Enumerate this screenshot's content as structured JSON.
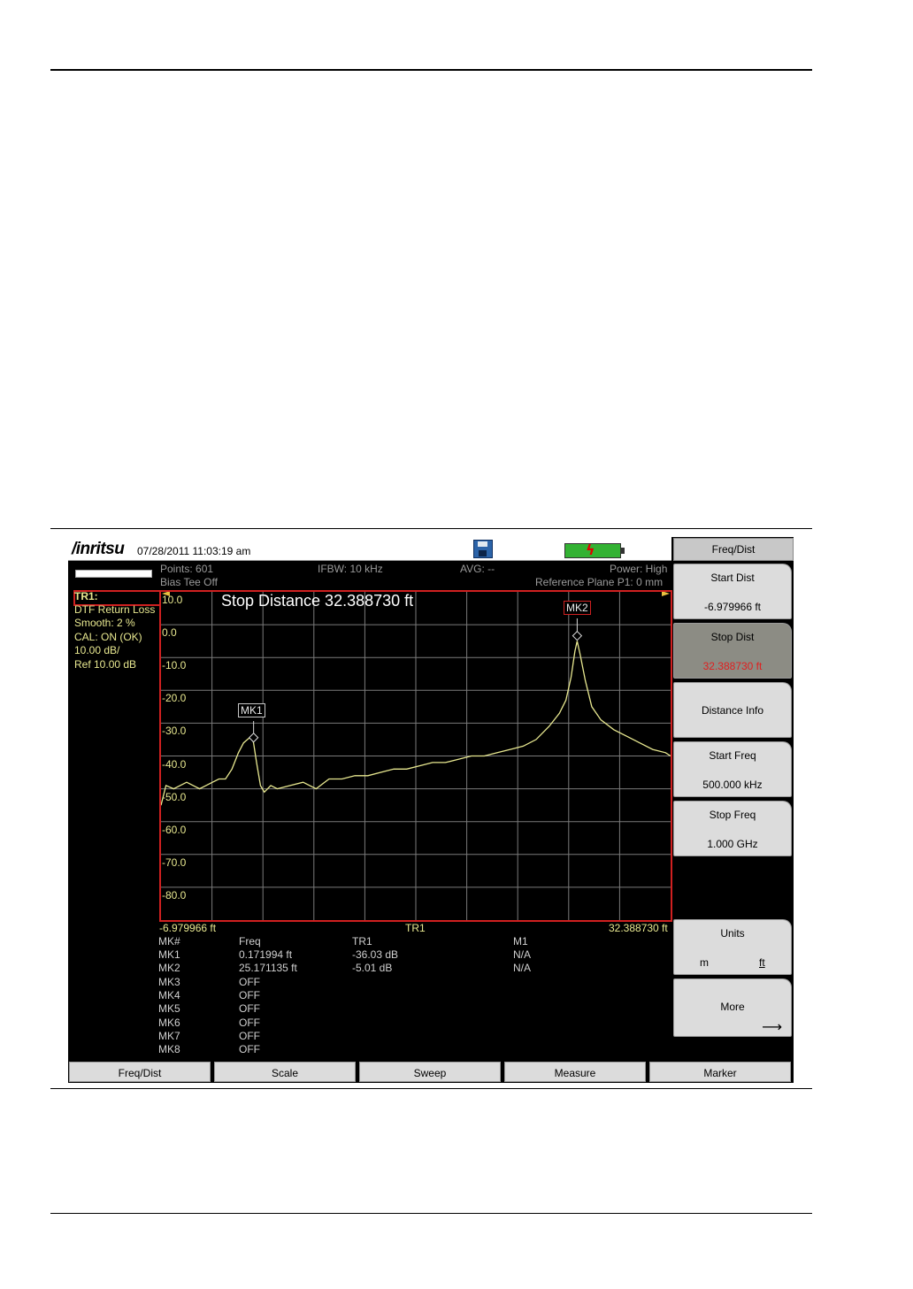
{
  "header": {
    "brand": "/inritsu",
    "datetime": "07/28/2011 11:03:19 am"
  },
  "status": {
    "points": "Points: 601",
    "ifbw": "IFBW: 10 kHz",
    "avg": "AVG: --",
    "power": "Power: High",
    "bias": "Bias Tee Off",
    "ref_plane": "Reference Plane P1: 0 mm"
  },
  "trace_info": {
    "tr": "TR1:",
    "mode": "DTF Return Loss",
    "smooth": "Smooth: 2 %",
    "cal": "CAL: ON (OK)",
    "scale": "10.00 dB/",
    "ref": "Ref 10.00 dB"
  },
  "plot": {
    "banner": "Stop Distance 32.388730 ft",
    "y_ticks": [
      "10.0",
      "0.0",
      "-10.0",
      "-20.0",
      "-30.0",
      "-40.0",
      "-50.0",
      "-60.0",
      "-70.0",
      "-80.0"
    ],
    "x_start": "-6.979966 ft",
    "x_center": "TR1",
    "x_stop": "32.388730 ft",
    "mk1_label": "MK1",
    "mk2_label": "MK2"
  },
  "chart_data": {
    "type": "line",
    "xlim": [
      -6.979966,
      32.38873
    ],
    "ylim": [
      -90,
      10
    ],
    "ylabel": "",
    "xlabel": "TR1",
    "series": [
      {
        "x": [
          -6.98,
          -6.6,
          -6.0,
          -5.0,
          -4.0,
          -3.0,
          -2.5,
          -2.0,
          -1.5,
          -1.0,
          -0.6,
          -0.3,
          0.0,
          0.17,
          0.4,
          0.7,
          1.0,
          1.5,
          2.0,
          3.0,
          4.0,
          5.0,
          6.0,
          7.0,
          8.0,
          9.0,
          10.0,
          11.0,
          12.0,
          13.0,
          14.0,
          15.0,
          16.0,
          17.0,
          18.0,
          19.0,
          20.0,
          21.0,
          22.0,
          23.0,
          23.8,
          24.3,
          24.7,
          25.0,
          25.17,
          25.4,
          25.8,
          26.3,
          27.0,
          28.0,
          29.0,
          30.0,
          31.0,
          32.0,
          32.39
        ],
        "y": [
          -55,
          -49,
          -50,
          -48,
          -50,
          -48,
          -47,
          -47,
          -44,
          -39,
          -36,
          -35,
          -34,
          -36,
          -42,
          -49,
          -51,
          -49,
          -50,
          -49,
          -48,
          -50,
          -47,
          -47,
          -46,
          -46,
          -45,
          -44,
          -44,
          -43,
          -42,
          -42,
          -41,
          -40,
          -40,
          -39,
          -38,
          -37,
          -35,
          -31,
          -27,
          -23,
          -16,
          -8,
          -5,
          -9,
          -17,
          -25,
          -29,
          -32,
          -34,
          -36,
          -38,
          -39,
          -40
        ]
      }
    ]
  },
  "markers": {
    "headers": [
      "MK#",
      "Freq",
      "TR1",
      "M1"
    ],
    "rows": [
      [
        "MK1",
        "0.171994 ft",
        "-36.03 dB",
        "N/A"
      ],
      [
        "MK2",
        "25.171135 ft",
        "-5.01 dB",
        "N/A"
      ],
      [
        "MK3",
        "OFF",
        "",
        ""
      ],
      [
        "MK4",
        "OFF",
        "",
        ""
      ],
      [
        "MK5",
        "OFF",
        "",
        ""
      ],
      [
        "MK6",
        "OFF",
        "",
        ""
      ],
      [
        "MK7",
        "OFF",
        "",
        ""
      ],
      [
        "MK8",
        "OFF",
        "",
        ""
      ]
    ]
  },
  "softkeys": {
    "title": "Freq/Dist",
    "start_dist_label": "Start Dist",
    "start_dist_value": "-6.979966 ft",
    "stop_dist_label": "Stop Dist",
    "stop_dist_value": "32.388730 ft",
    "distance_info": "Distance Info",
    "start_freq_label": "Start Freq",
    "start_freq_value": "500.000 kHz",
    "stop_freq_label": "Stop Freq",
    "stop_freq_value": "1.000 GHz",
    "units_label": "Units",
    "units_m": "m",
    "units_ft": "ft",
    "more": "More",
    "more_arrow": "⟶"
  },
  "menu": [
    "Freq/Dist",
    "Scale",
    "Sweep",
    "Measure",
    "Marker"
  ],
  "colors": {
    "trace": "#e8e890",
    "grid": "#7a7a7a",
    "frame": "#d02020",
    "stop_value": "#e02020"
  }
}
